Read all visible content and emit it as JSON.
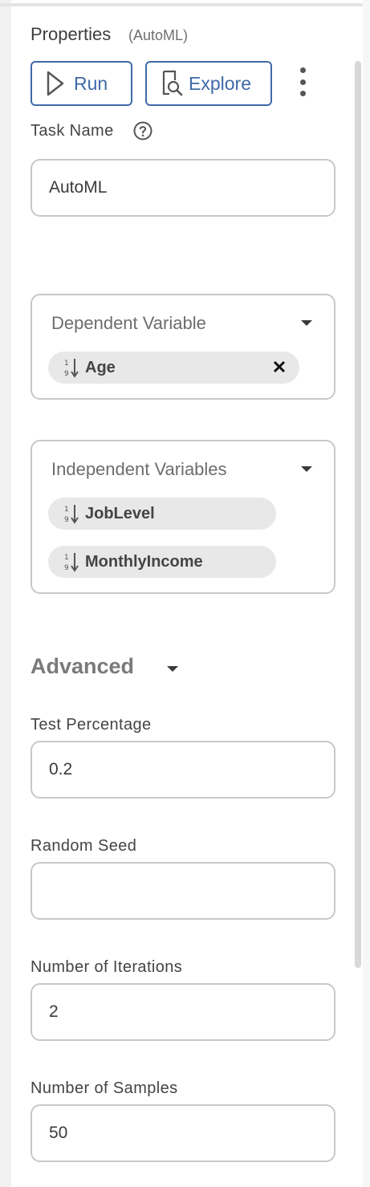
{
  "header": {
    "title": "Properties",
    "subtitle": "(AutoML)"
  },
  "toolbar": {
    "run_label": "Run",
    "explore_label": "Explore"
  },
  "task_name": {
    "label": "Task Name",
    "value": "AutoML"
  },
  "dependent_variable": {
    "title": "Dependent Variable",
    "chips": [
      {
        "label": "Age"
      }
    ]
  },
  "independent_variables": {
    "title": "Independent Variables",
    "chips": [
      {
        "label": "JobLevel"
      },
      {
        "label": "MonthlyIncome"
      }
    ]
  },
  "advanced": {
    "title": "Advanced",
    "fields": {
      "test_percentage": {
        "label": "Test Percentage",
        "value": "0.2"
      },
      "random_seed": {
        "label": "Random Seed",
        "value": ""
      },
      "number_of_iterations": {
        "label": "Number of Iterations",
        "value": "2"
      },
      "number_of_samples": {
        "label": "Number of Samples",
        "value": "50"
      }
    }
  },
  "colors": {
    "accent": "#3f6aa8",
    "border": "#c8c8c8",
    "chip_bg": "#e8e8e8"
  },
  "icons": {
    "run": "play-outline-icon",
    "explore": "search-document-icon",
    "menu": "kebab-menu-icon",
    "help": "question-circle-icon",
    "numeric_variable": "numeric-sort-icon",
    "remove": "close-icon",
    "dropdown": "caret-down-icon"
  }
}
